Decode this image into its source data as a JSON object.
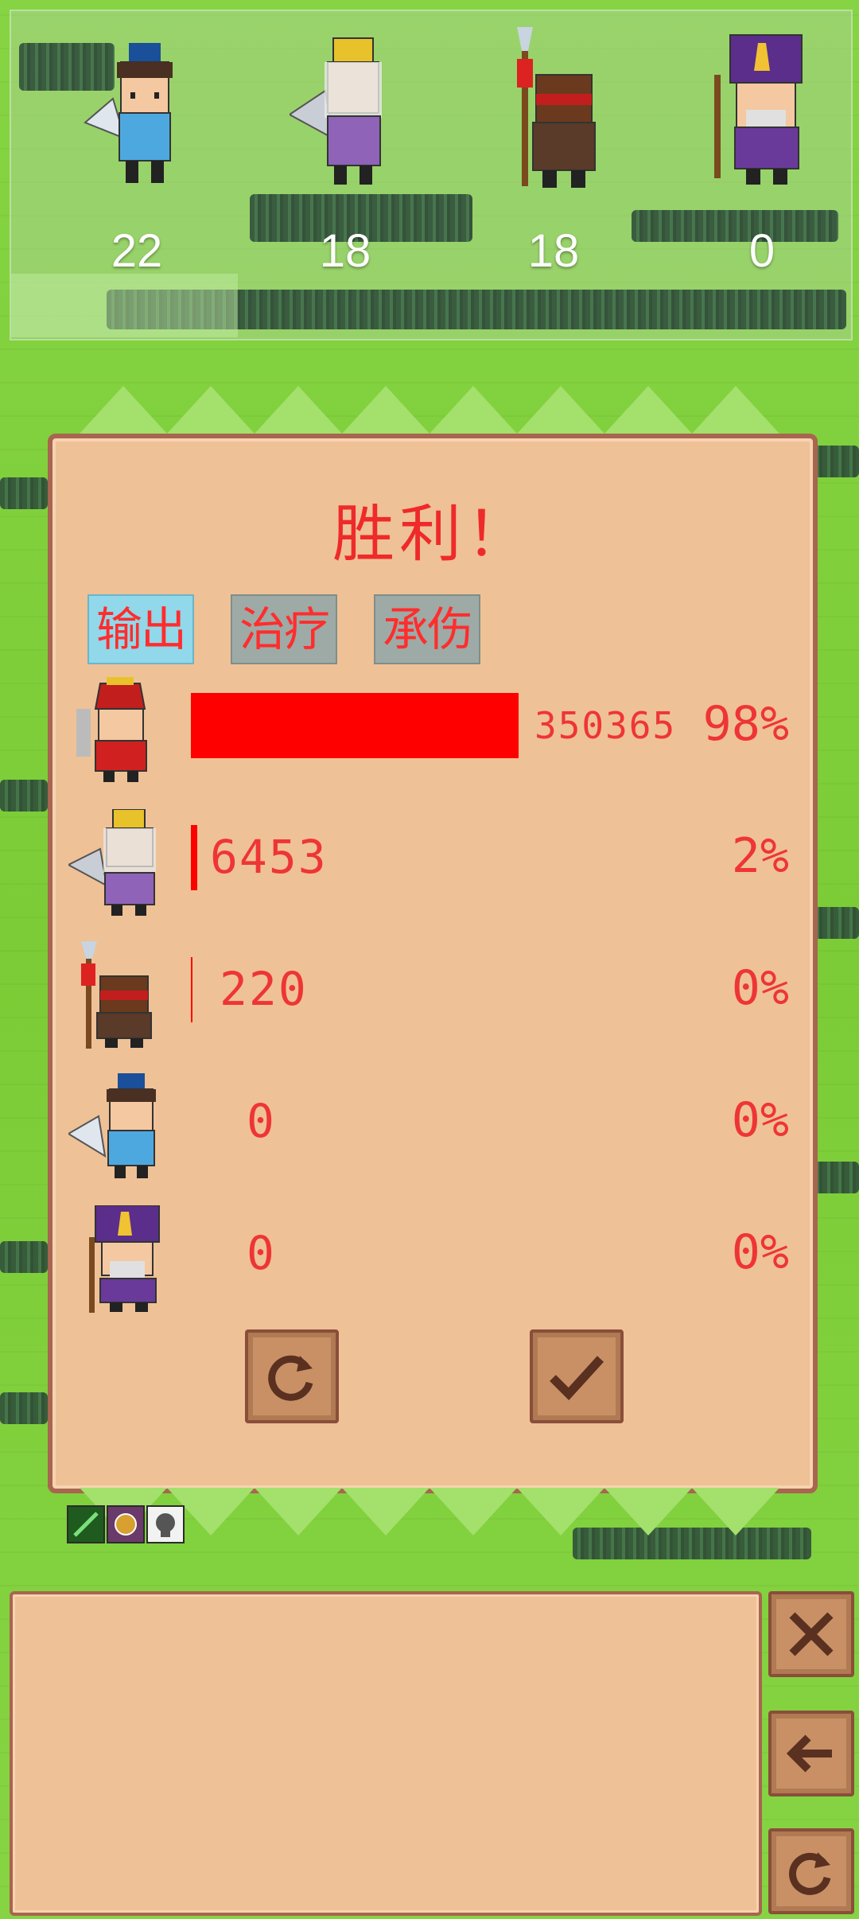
{
  "team": {
    "slots": [
      {
        "level": "22",
        "hero": "advisor-fan-hero"
      },
      {
        "level": "18",
        "hero": "elder-sage-hero"
      },
      {
        "level": "18",
        "hero": "spear-warrior-hero"
      },
      {
        "level": "0",
        "hero": "purple-official-hero"
      }
    ]
  },
  "result": {
    "title": "胜利！",
    "tabs": [
      "输出",
      "治疗",
      "承伤"
    ],
    "active_tab": 0,
    "rows": [
      {
        "hero": "red-general-hero",
        "value": "350365",
        "percent": "98%",
        "share": 0.98
      },
      {
        "hero": "elder-sage-hero",
        "value": "6453",
        "percent": "2%",
        "share": 0.02
      },
      {
        "hero": "spear-warrior-hero",
        "value": "220",
        "percent": "0%",
        "share": 0.0
      },
      {
        "hero": "advisor-fan-hero",
        "value": "0",
        "percent": "0%",
        "share": 0.0
      },
      {
        "hero": "purple-official-hero",
        "value": "0",
        "percent": "0%",
        "share": 0.0
      }
    ],
    "buttons": {
      "retry": "retry-icon",
      "confirm": "check-icon"
    }
  },
  "buffs": [
    "sword-buff-icon",
    "orb-buff-icon",
    "skull-buff-icon"
  ],
  "side_buttons": [
    "close-icon",
    "back-arrow-icon",
    "retry-icon"
  ],
  "colors": {
    "bar": "#ff0000",
    "text": "#ee3535",
    "panel": "#efc196",
    "border": "#a8654f",
    "tab_active": "#90d8ea",
    "tab_inactive": "#9eaaa6"
  }
}
